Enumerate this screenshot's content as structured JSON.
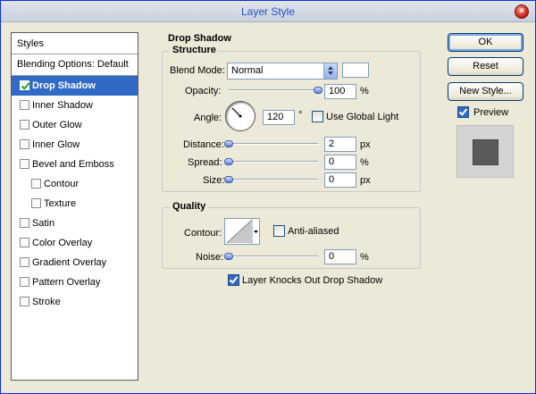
{
  "window": {
    "title": "Layer Style",
    "close_glyph": "×"
  },
  "styles_panel": {
    "header": "Styles",
    "blending_options": "Blending Options: Default",
    "items": [
      {
        "label": "Drop Shadow",
        "checked": true,
        "selected": true
      },
      {
        "label": "Inner Shadow",
        "checked": false
      },
      {
        "label": "Outer Glow",
        "checked": false
      },
      {
        "label": "Inner Glow",
        "checked": false
      },
      {
        "label": "Bevel and Emboss",
        "checked": false
      },
      {
        "label": "Contour",
        "checked": false
      },
      {
        "label": "Texture",
        "checked": false
      },
      {
        "label": "Satin",
        "checked": false
      },
      {
        "label": "Color Overlay",
        "checked": false
      },
      {
        "label": "Gradient Overlay",
        "checked": false
      },
      {
        "label": "Pattern Overlay",
        "checked": false
      },
      {
        "label": "Stroke",
        "checked": false
      }
    ]
  },
  "drop_shadow": {
    "title": "Drop Shadow",
    "structure": {
      "title": "Structure",
      "blend_mode": {
        "label": "Blend Mode:",
        "value": "Normal",
        "color": "#ffffff"
      },
      "opacity": {
        "label": "Opacity:",
        "value": "100",
        "unit": "%",
        "slider_fraction": 1.0
      },
      "angle": {
        "label": "Angle:",
        "value": "120",
        "unit": "°",
        "global_light_label": "Use Global Light",
        "global_light_checked": false
      },
      "distance": {
        "label": "Distance:",
        "value": "2",
        "unit": "px",
        "slider_fraction": 0.0
      },
      "spread": {
        "label": "Spread:",
        "value": "0",
        "unit": "%",
        "slider_fraction": 0.0
      },
      "size": {
        "label": "Size:",
        "value": "0",
        "unit": "px",
        "slider_fraction": 0.0
      }
    },
    "quality": {
      "title": "Quality",
      "contour_label": "Contour:",
      "anti_aliased_label": "Anti-aliased",
      "anti_aliased_checked": false,
      "noise": {
        "label": "Noise:",
        "value": "0",
        "unit": "%",
        "slider_fraction": 0.0
      }
    },
    "knocks_out": {
      "label": "Layer Knocks Out Drop Shadow",
      "checked": true
    }
  },
  "buttons": {
    "ok": "OK",
    "reset": "Reset",
    "new_style": "New Style..."
  },
  "preview": {
    "label": "Preview",
    "checked": true
  }
}
